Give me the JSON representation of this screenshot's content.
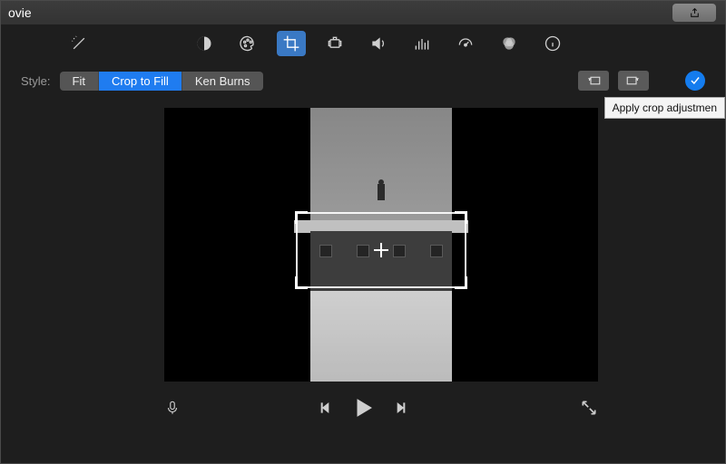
{
  "titlebar": {
    "title": "ovie"
  },
  "toolbar": {
    "icons": [
      {
        "name": "wand-icon"
      },
      {
        "name": "color-balance-icon"
      },
      {
        "name": "color-palette-icon"
      },
      {
        "name": "crop-icon",
        "active": true
      },
      {
        "name": "stabilize-icon"
      },
      {
        "name": "volume-icon"
      },
      {
        "name": "equalizer-icon"
      },
      {
        "name": "speed-icon"
      },
      {
        "name": "color-filter-icon"
      },
      {
        "name": "info-icon"
      }
    ]
  },
  "style": {
    "label": "Style:",
    "options": [
      "Fit",
      "Crop to Fill",
      "Ken Burns"
    ],
    "active": "Crop to Fill",
    "tooltip": "Apply crop adjustmen"
  },
  "transport": {
    "items": [
      "mic",
      "skip-back",
      "play",
      "skip-forward",
      "fullscreen"
    ]
  }
}
